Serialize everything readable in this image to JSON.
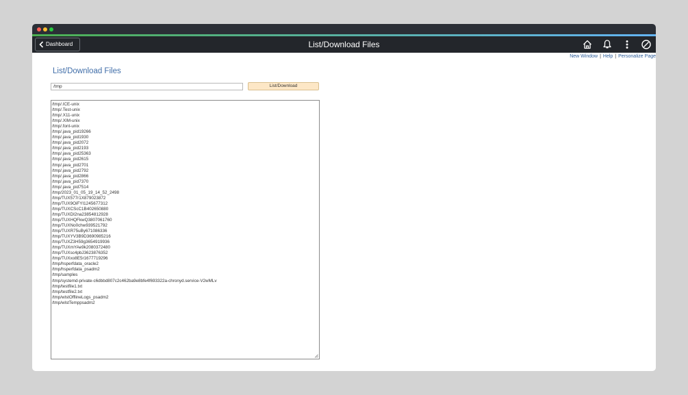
{
  "header": {
    "back_label": "Dashboard",
    "title": "List/Download Files",
    "icons": [
      "home-icon",
      "bell-icon",
      "more-vertical-icon",
      "navbar-icon"
    ]
  },
  "links": {
    "new_window": "New Window",
    "help": "Help",
    "personalize": "Personalize Page"
  },
  "page": {
    "title": "List/Download Files",
    "path_value": "/tmp",
    "button_label": "List/Download"
  },
  "files": [
    "/tmp/.ICE-unix",
    "/tmp/.Test-unix",
    "/tmp/.X11-unix",
    "/tmp/.XIM-unix",
    "/tmp/.font-unix",
    "/tmp/.java_pid19266",
    "/tmp/.java_pid1930",
    "/tmp/.java_pid2072",
    "/tmp/.java_pid2193",
    "/tmp/.java_pid25363",
    "/tmp/.java_pid2615",
    "/tmp/.java_pid2701",
    "/tmp/.java_pid2792",
    "/tmp/.java_pid2866",
    "/tmp/.java_pid7370",
    "/tmp/.java_pid7514",
    "/tmp/2023_01_05_19_14_52_2498",
    "/tmp/TUX577r1X879023872",
    "/tmp/TUX9OiFYI1245677312",
    "/tmp/TUXCScC1B402650880",
    "/tmp/TUXDI2na23854812928",
    "/tmp/TUXHQFkwQ3807061760",
    "/tmp/TUXNo0chw939521792",
    "/tmp/TUXR75uBy671086336",
    "/tmp/TUXYV3B9D3690985216",
    "/tmp/TUXZ3H59g3654919936",
    "/tmp/TUXmYAe9k2080372480",
    "/tmp/TUXsc4pbJ3623876352",
    "/tmp/TUXxo8E5r1677719296",
    "/tmp/hsperfdata_oracle2",
    "/tmp/hsperfdata_psadm2",
    "/tmp/samples",
    "/tmp/systemd-private-c6dbbd807c2c462ba9e8bfe4f693322a-chronyd.service-V2wMLv",
    "/tmp/testfile1.txt",
    "/tmp/testfile2.txt",
    "/tmp/wlstOfflineLogs_psadm2",
    "/tmp/wlstTemppsadm2"
  ]
}
